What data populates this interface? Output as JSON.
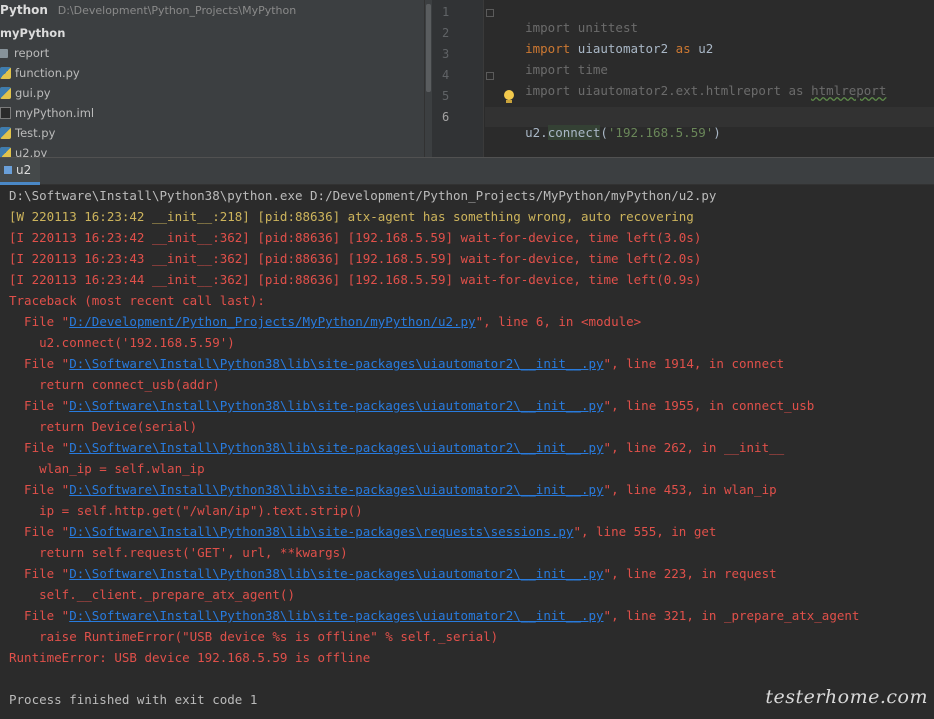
{
  "project": {
    "header_name": "Python",
    "header_path": "D:\\Development\\Python_Projects\\MyPython",
    "root": "myPython",
    "items": [
      {
        "label": "report",
        "icon": "folder-icon"
      },
      {
        "label": "function.py",
        "icon": "python-file-icon"
      },
      {
        "label": "gui.py",
        "icon": "python-file-icon"
      },
      {
        "label": "myPython.iml",
        "icon": "iml-file-icon"
      },
      {
        "label": "Test.py",
        "icon": "python-file-icon"
      },
      {
        "label": "u2.py",
        "icon": "python-file-icon"
      }
    ]
  },
  "editor": {
    "line_numbers": [
      "1",
      "2",
      "3",
      "4",
      "5",
      "6"
    ],
    "current_line": "6",
    "lines": {
      "l1": {
        "kw": "import",
        "rest": " unittest"
      },
      "l2": {
        "kw": "import",
        "mid": " uiautomator2 ",
        "as": "as",
        "rest": " u2"
      },
      "l3": {
        "kw": "import",
        "rest": " time"
      },
      "l4": {
        "kw": "import",
        "mid": " uiautomator2.ext.htmlreport as ",
        "alias": "htmlreport"
      },
      "l6": {
        "obj": "u2.",
        "call": "connect",
        "open": "(",
        "str": "'192.168.5.59'",
        "close": ")"
      }
    }
  },
  "run": {
    "tab_label": "u2"
  },
  "console": {
    "cmd": "D:\\Software\\Install\\Python38\\python.exe D:/Development/Python_Projects/MyPython/myPython/u2.py",
    "log1": "[W 220113 16:23:42 __init__:218] [pid:88636] atx-agent has something wrong, auto recovering",
    "log2": "[I 220113 16:23:42 __init__:362] [pid:88636] [192.168.5.59] wait-for-device, time left(3.0s)",
    "log3": "[I 220113 16:23:43 __init__:362] [pid:88636] [192.168.5.59] wait-for-device, time left(2.0s)",
    "log4": "[I 220113 16:23:44 __init__:362] [pid:88636] [192.168.5.59] wait-for-device, time left(0.9s)",
    "traceback": "Traceback (most recent call last):",
    "frames": [
      {
        "path": "D:/Development/Python_Projects/MyPython/myPython/u2.py",
        "tail": "\", line 6, in <module>",
        "code": "    u2.connect('192.168.5.59')"
      },
      {
        "path": "D:\\Software\\Install\\Python38\\lib\\site-packages\\uiautomator2\\__init__.py",
        "tail": "\", line 1914, in connect",
        "code": "    return connect_usb(addr)"
      },
      {
        "path": "D:\\Software\\Install\\Python38\\lib\\site-packages\\uiautomator2\\__init__.py",
        "tail": "\", line 1955, in connect_usb",
        "code": "    return Device(serial)"
      },
      {
        "path": "D:\\Software\\Install\\Python38\\lib\\site-packages\\uiautomator2\\__init__.py",
        "tail": "\", line 262, in __init__",
        "code": "    wlan_ip = self.wlan_ip"
      },
      {
        "path": "D:\\Software\\Install\\Python38\\lib\\site-packages\\uiautomator2\\__init__.py",
        "tail": "\", line 453, in wlan_ip",
        "code": "    ip = self.http.get(\"/wlan/ip\").text.strip()"
      },
      {
        "path": "D:\\Software\\Install\\Python38\\lib\\site-packages\\requests\\sessions.py",
        "tail": "\", line 555, in get",
        "code": "    return self.request('GET', url, **kwargs)"
      },
      {
        "path": "D:\\Software\\Install\\Python38\\lib\\site-packages\\uiautomator2\\__init__.py",
        "tail": "\", line 223, in request",
        "code": "    self.__client._prepare_atx_agent()"
      },
      {
        "path": "D:\\Software\\Install\\Python38\\lib\\site-packages\\uiautomator2\\__init__.py",
        "tail": "\", line 321, in _prepare_atx_agent",
        "code": "    raise RuntimeError(\"USB device %s is offline\" % self._serial)"
      }
    ],
    "file_prefix": "  File \"",
    "error": "RuntimeError: USB device 192.168.5.59 is offline",
    "finished": "Process finished with exit code 1"
  },
  "watermark": "testerhome.com"
}
